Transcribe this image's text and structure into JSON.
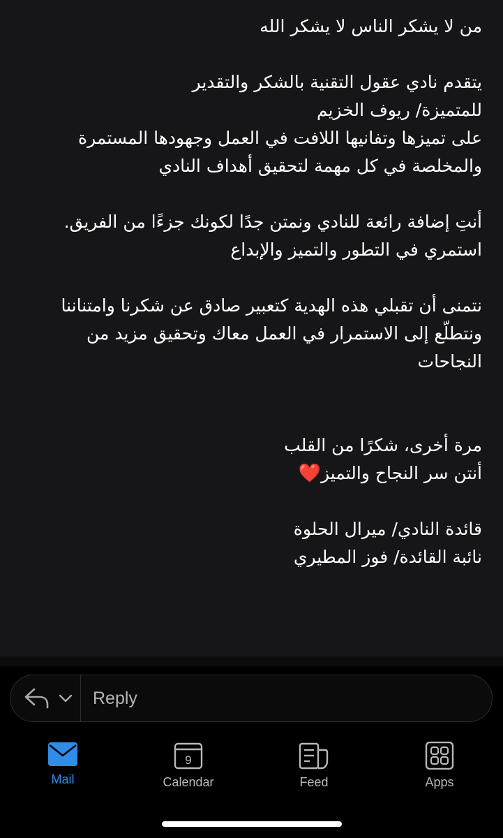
{
  "message": {
    "lines": [
      "من لا يشكر الناس لا يشكر الله",
      "يتقدم نادي عقول التقنية بالشكر والتقدير",
      "للمتميزة/ ريوف الخزيم",
      "على تميزها وتفانيها اللافت في العمل وجهودها المستمرة",
      "والمخلصة في كل مهمة لتحقيق أهداف النادي",
      "أنتِ إضافة رائعة للنادي ونمتن جدًا لكونك جزءًا من الفريق.",
      "استمري في التطور والتميز والإبداع",
      "نتمنى أن تقبلي هذه الهدية كتعبير صادق عن شكرنا وامتناننا",
      "ونتطلّع إلى الاستمرار في العمل معاك وتحقيق مزيد من",
      "النجاحات",
      "مرة أخرى، شكرًا من القلب",
      "أنتن سر النجاح والتميز",
      "قائدة النادي/ ميرال الحلوة",
      "نائبة القائدة/ فوز المطيري"
    ],
    "heart_emoji": "❤️"
  },
  "reply": {
    "placeholder": "Reply",
    "icons": [
      "reply-arrow-icon",
      "chevron-down-icon"
    ]
  },
  "tabs": [
    {
      "label": "Mail",
      "icon": "mail-icon",
      "active": true
    },
    {
      "label": "Calendar",
      "icon": "calendar-icon",
      "day": "9",
      "active": false
    },
    {
      "label": "Feed",
      "icon": "feed-icon",
      "active": false
    },
    {
      "label": "Apps",
      "icon": "apps-grid-icon",
      "active": false
    }
  ],
  "colors": {
    "accent": "#2f8ce8",
    "background": "#161618",
    "text": "#ffffff",
    "muted": "#b8b8bc"
  }
}
